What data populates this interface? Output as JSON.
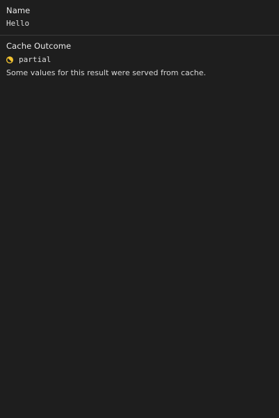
{
  "name_section": {
    "label": "Name",
    "value": "Hello"
  },
  "cache_section": {
    "label": "Cache Outcome",
    "status_icon": "half-filled-circle-icon",
    "status_color": "#f2c230",
    "value": "partial",
    "description": "Some values for this result were served from cache."
  }
}
